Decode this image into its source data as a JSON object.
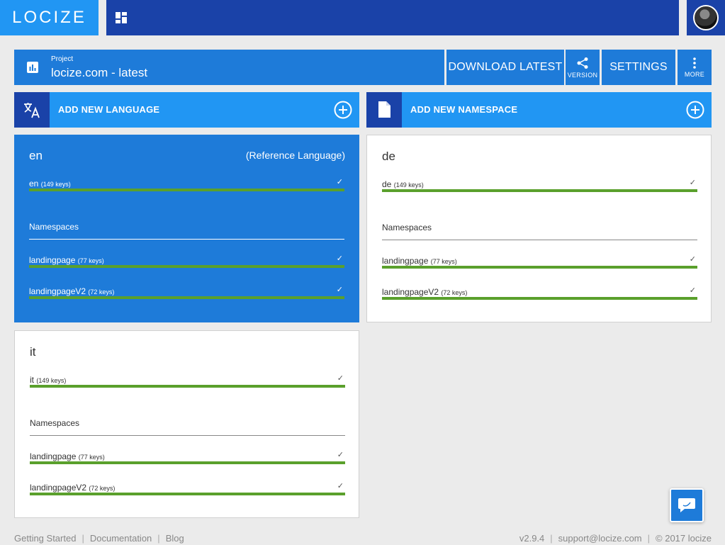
{
  "logo": {
    "text": "LOCIZE"
  },
  "project": {
    "label": "Project",
    "name": "locize.com - latest"
  },
  "toolbar": {
    "download": "DOWNLOAD LATEST",
    "version": "VERSION",
    "settings": "SETTINGS",
    "more": "MORE"
  },
  "add_language": "ADD NEW LANGUAGE",
  "add_namespace": "ADD NEW NAMESPACE",
  "languages": [
    {
      "code": "en",
      "reference_label": "(Reference Language)",
      "total": {
        "name": "en",
        "keys": "(149 keys)"
      },
      "namespaces_label": "Namespaces",
      "namespaces": [
        {
          "name": "landingpage",
          "keys": "(77 keys)"
        },
        {
          "name": "landingpageV2",
          "keys": "(72 keys)"
        }
      ]
    },
    {
      "code": "de",
      "total": {
        "name": "de",
        "keys": "(149 keys)"
      },
      "namespaces_label": "Namespaces",
      "namespaces": [
        {
          "name": "landingpage",
          "keys": "(77 keys)"
        },
        {
          "name": "landingpageV2",
          "keys": "(72 keys)"
        }
      ]
    },
    {
      "code": "it",
      "total": {
        "name": "it",
        "keys": "(149 keys)"
      },
      "namespaces_label": "Namespaces",
      "namespaces": [
        {
          "name": "landingpage",
          "keys": "(77 keys)"
        },
        {
          "name": "landingpageV2",
          "keys": "(72 keys)"
        }
      ]
    }
  ],
  "footer": {
    "links": [
      "Getting Started",
      "Documentation",
      "Blog"
    ],
    "version": "v2.9.4",
    "support": "support@locize.com",
    "copyright": "© 2017 locize"
  },
  "colors": {
    "primary": "#1e7bd9",
    "accent": "#2196f3",
    "dark": "#1a42a8",
    "progress": "#5aa02c"
  }
}
